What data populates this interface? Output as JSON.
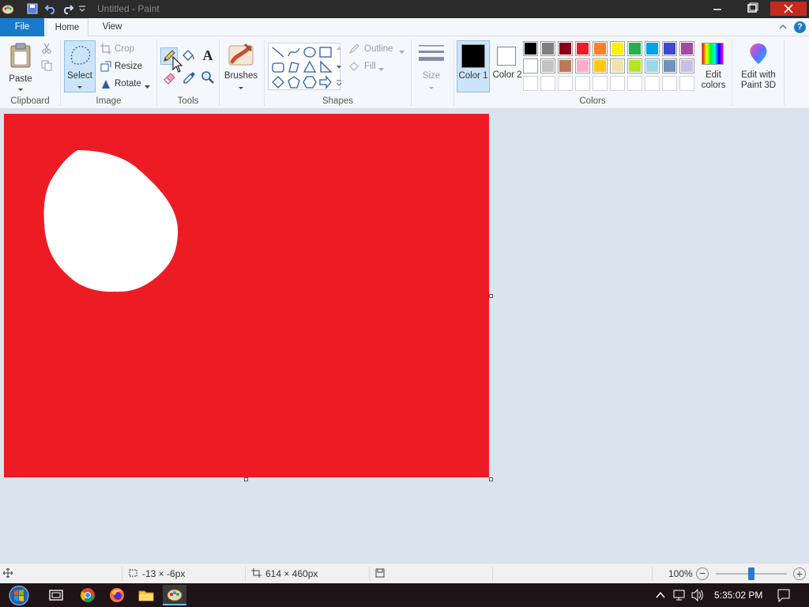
{
  "window": {
    "title": "Untitled - Paint",
    "controls": [
      "minimize",
      "maximize",
      "close"
    ]
  },
  "tabs": {
    "file": "File",
    "home": "Home",
    "view": "View",
    "active": "Home"
  },
  "ribbon": {
    "clipboard": {
      "paste": "Paste",
      "group": "Clipboard"
    },
    "image": {
      "select": "Select",
      "crop": "Crop",
      "resize": "Resize",
      "rotate": "Rotate",
      "group": "Image"
    },
    "tools": {
      "group": "Tools"
    },
    "brushes": {
      "label": "Brushes"
    },
    "shapes": {
      "outline": "Outline",
      "fill": "Fill",
      "group": "Shapes"
    },
    "size": {
      "label": "Size"
    },
    "colors": {
      "color1": "Color 1",
      "color1_value": "#000000",
      "color2": "Color 2",
      "color2_value": "#ffffff",
      "group": "Colors",
      "edit_colors": "Edit colors",
      "paint3d": "Edit with Paint 3D",
      "palette_row1": [
        "#000000",
        "#7f7f7f",
        "#880015",
        "#ed1c24",
        "#ff7f27",
        "#fff200",
        "#22b14c",
        "#00a2e8",
        "#3f48cc",
        "#a349a4"
      ],
      "palette_row2": [
        "#ffffff",
        "#c3c3c3",
        "#b97a57",
        "#ffaec9",
        "#ffc90e",
        "#efe4b0",
        "#b5e61d",
        "#99d9ea",
        "#7092be",
        "#c8bfe7"
      ],
      "palette_row3": [
        "#ffffff",
        "#ffffff",
        "#ffffff",
        "#ffffff",
        "#ffffff",
        "#ffffff",
        "#ffffff",
        "#ffffff",
        "#ffffff",
        "#ffffff"
      ]
    }
  },
  "canvas": {
    "background": "#ed1c24",
    "shape_fill": "#ffffff"
  },
  "status": {
    "cursor_pos": "-13 × -6px",
    "canvas_size": "614 × 460px",
    "zoom": "100%",
    "zoom_slider_percent": 100
  },
  "taskbar": {
    "clock": "5:35:02 PM"
  }
}
